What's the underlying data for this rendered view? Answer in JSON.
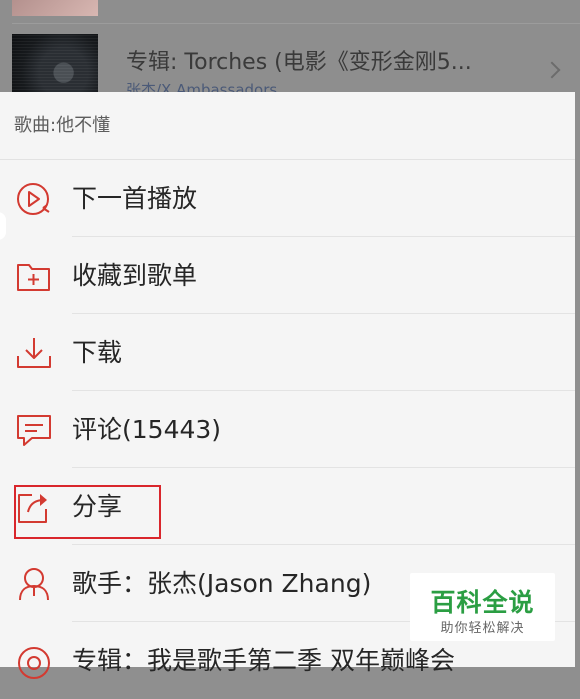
{
  "background": {
    "album_title": "专辑: Torches (电影《变形金刚5...",
    "album_subtitle": "张杰/X Ambassadors"
  },
  "sheet": {
    "header": "歌曲:他不懂",
    "items": [
      {
        "label": "下一首播放",
        "icon": "play-next-icon"
      },
      {
        "label": "收藏到歌单",
        "icon": "add-to-playlist-icon"
      },
      {
        "label": "下载",
        "icon": "download-icon"
      },
      {
        "label": "评论(15443)",
        "icon": "comment-icon"
      },
      {
        "label": "分享",
        "icon": "share-icon"
      },
      {
        "label": "歌手：张杰(Jason Zhang)",
        "icon": "singer-icon"
      },
      {
        "label": "专辑：我是歌手第二季 双年巅峰会",
        "icon": "album-icon"
      }
    ]
  },
  "watermark": {
    "title": "百科全说",
    "subtitle": "助你轻松解决"
  },
  "colors": {
    "accent": "#d33a31",
    "highlight_box": "#d9262c",
    "watermark_green": "#2b9e43"
  }
}
